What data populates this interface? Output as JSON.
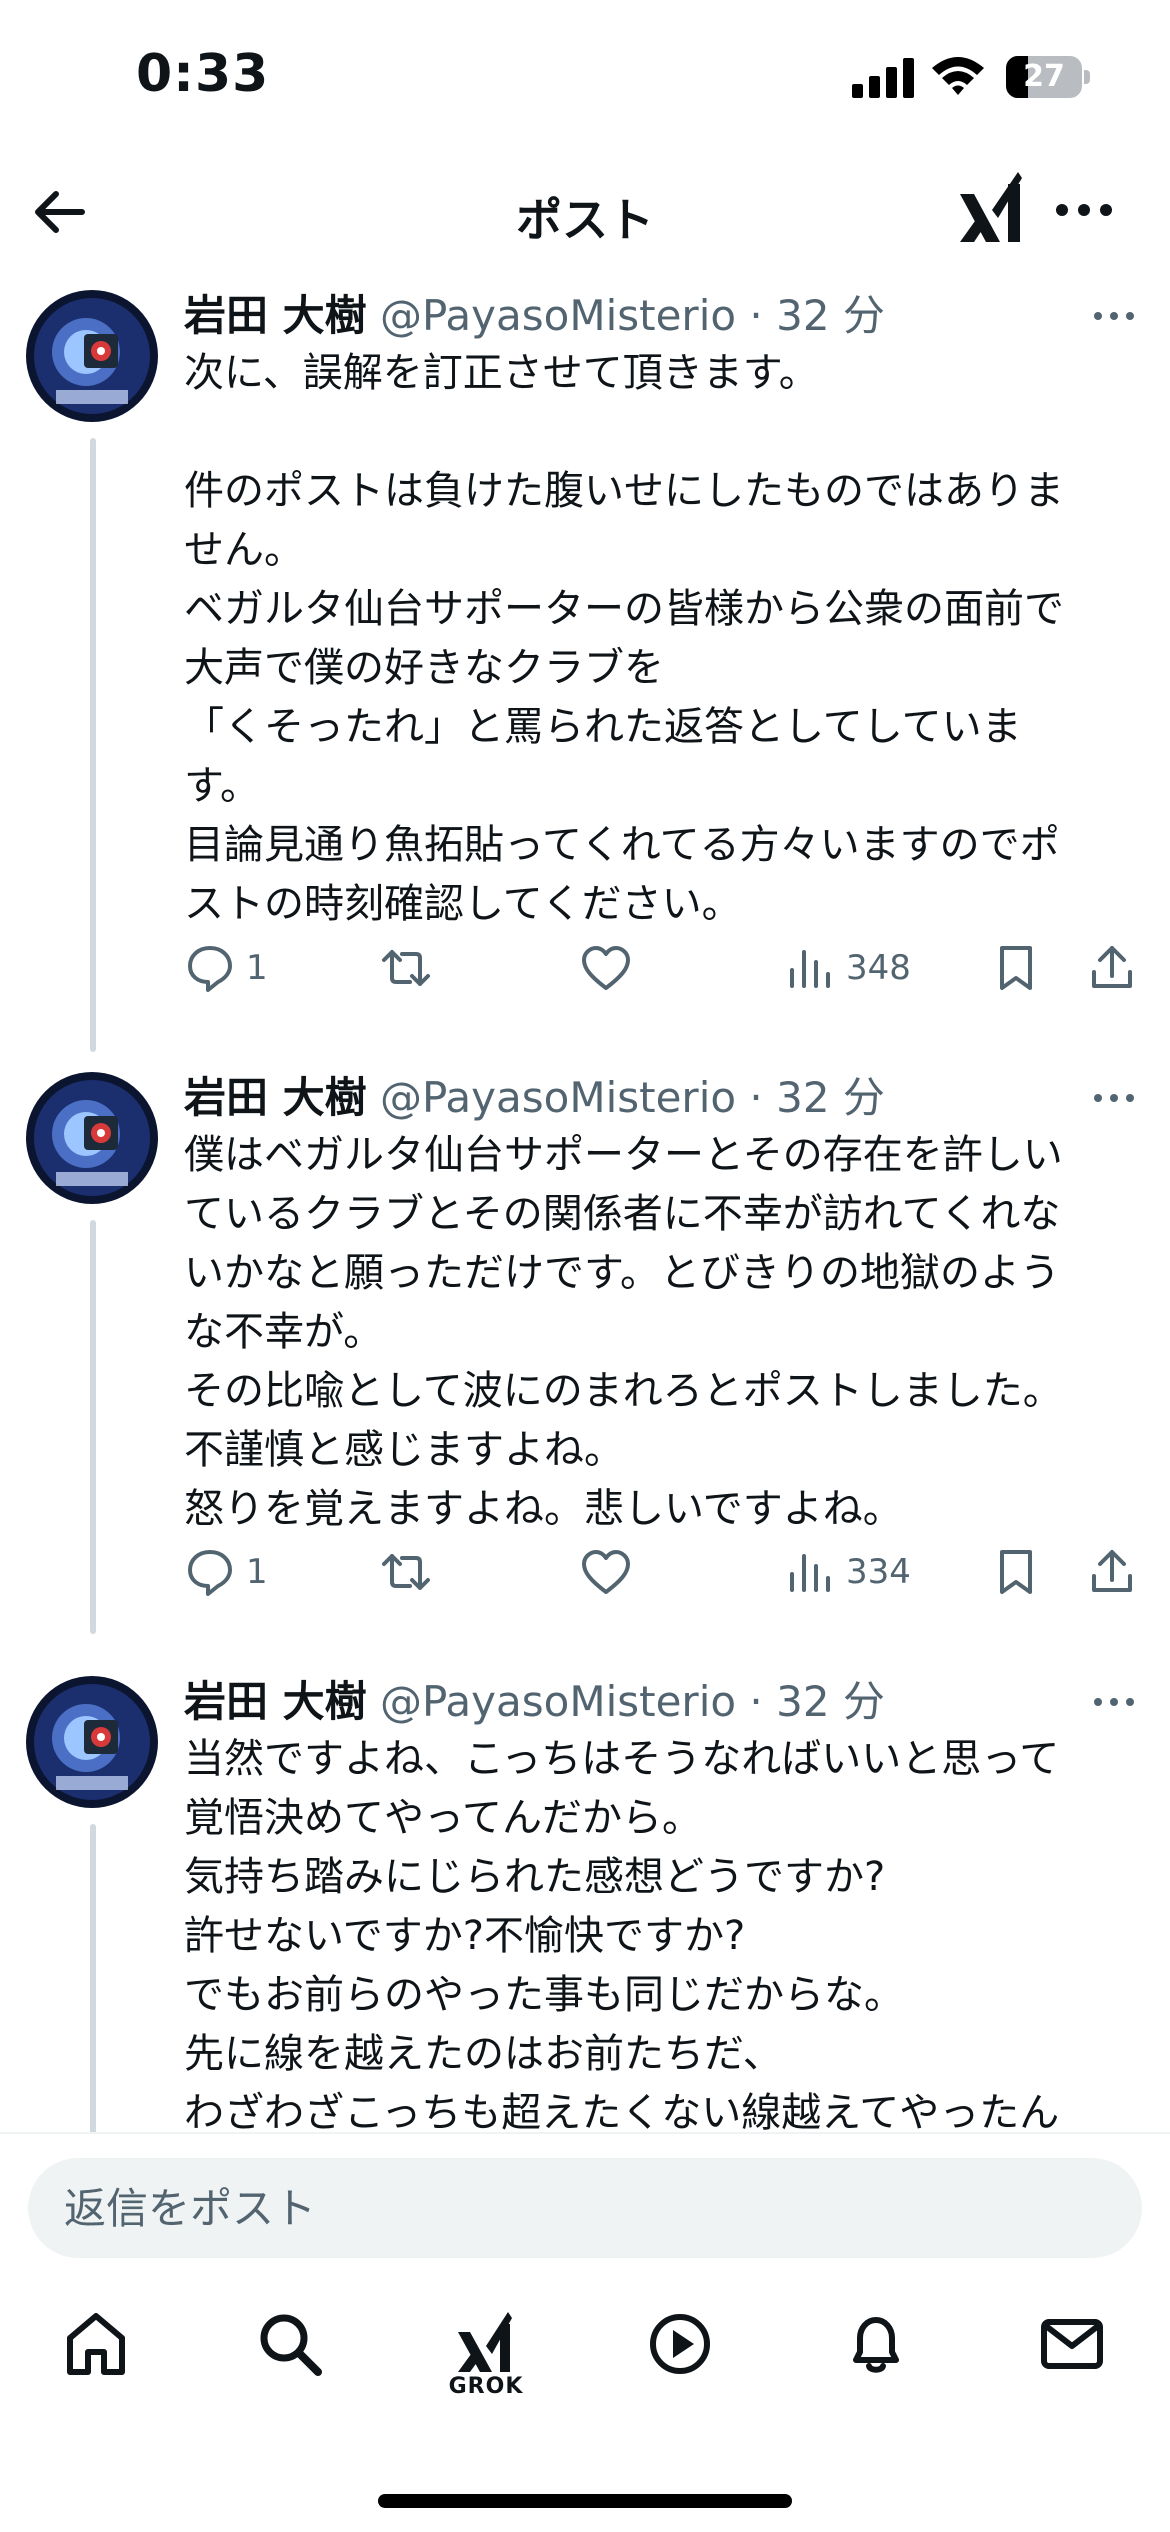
{
  "status_bar": {
    "time": "0:33",
    "battery": "27"
  },
  "header": {
    "title": "ポスト"
  },
  "posts": [
    {
      "author": "岩田 大樹",
      "handle": "@PayasoMisterio",
      "separator": "·",
      "time": "32 分",
      "lines": [
        "次に、誤解を訂正させて頂きます。",
        "",
        "件のポストは負けた腹いせにしたものではありま",
        "せん。",
        "ベガルタ仙台サポーターの皆様から公衆の面前で",
        "大声で僕の好きなクラブを",
        "「くそったれ」と罵られた返答としてしていま",
        "す。",
        "目論見通り魚拓貼ってくれてる方々いますのでポ",
        "ストの時刻確認してください。"
      ],
      "replies": "1",
      "views": "348"
    },
    {
      "author": "岩田 大樹",
      "handle": "@PayasoMisterio",
      "separator": "·",
      "time": "32 分",
      "lines": [
        "僕はベガルタ仙台サポーターとその存在を許しい",
        "ているクラブとその関係者に不幸が訪れてくれな",
        "いかなと願っただけです。とびきりの地獄のよう",
        "な不幸が。",
        "その比喩として波にのまれろとポストしました。",
        "不謹慎と感じますよね。",
        "怒りを覚えますよね。悲しいですよね。"
      ],
      "replies": "1",
      "views": "334"
    },
    {
      "author": "岩田 大樹",
      "handle": "@PayasoMisterio",
      "separator": "·",
      "time": "32 分",
      "lines": [
        "当然ですよね、こっちはそうなればいいと思って",
        "覚悟決めてやってんだから。",
        "気持ち踏みにじられた感想どうですか?",
        "許せないですか?不愉快ですか?",
        "でもお前らのやった事も同じだからな。",
        "先に線を越えたのはお前たちだ、",
        "わざわざこっちも超えたくない線越えてやったん"
      ]
    }
  ],
  "reply": {
    "placeholder": "返信をポスト"
  },
  "nav": {
    "items": [
      "home-icon",
      "search-icon",
      "grok-icon",
      "play-icon",
      "bell-icon",
      "mail-icon"
    ],
    "grok_label": "GROK"
  },
  "colors": {
    "text": "#0f1419",
    "secondary": "#536471",
    "thread_line": "#cfd9de",
    "input_bg": "#eff3f4"
  }
}
